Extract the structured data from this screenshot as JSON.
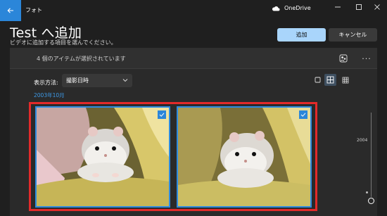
{
  "titlebar": {
    "app_name": "フォト",
    "onedrive_label": "OneDrive"
  },
  "header": {
    "title": "Test へ追加",
    "subtitle": "ビデオに追加する項目を選んでください。",
    "add_label": "追加",
    "cancel_label": "キャンセル"
  },
  "selection": {
    "count_text": "4 個のアイテムが選択されています"
  },
  "view": {
    "label": "表示方法:",
    "selected": "撮影日時"
  },
  "gallery": {
    "month": "2003年10月",
    "photos": [
      {
        "name": "hamster-photo-1",
        "selected": true
      },
      {
        "name": "hamster-photo-2",
        "selected": true
      }
    ]
  },
  "timeline": {
    "year": "2004"
  },
  "colors": {
    "accent": "#2b86d9",
    "primary_button": "#a9d5fb",
    "highlight_frame": "#e22a2a"
  },
  "icons": {
    "back": "arrow-left-icon",
    "onedrive": "cloud-icon",
    "people": "people-icon",
    "more": "more-icon",
    "view_single": "single-square-icon",
    "view_grid4": "grid-4-icon",
    "view_grid9": "grid-9-icon",
    "check": "checkmark-icon"
  }
}
